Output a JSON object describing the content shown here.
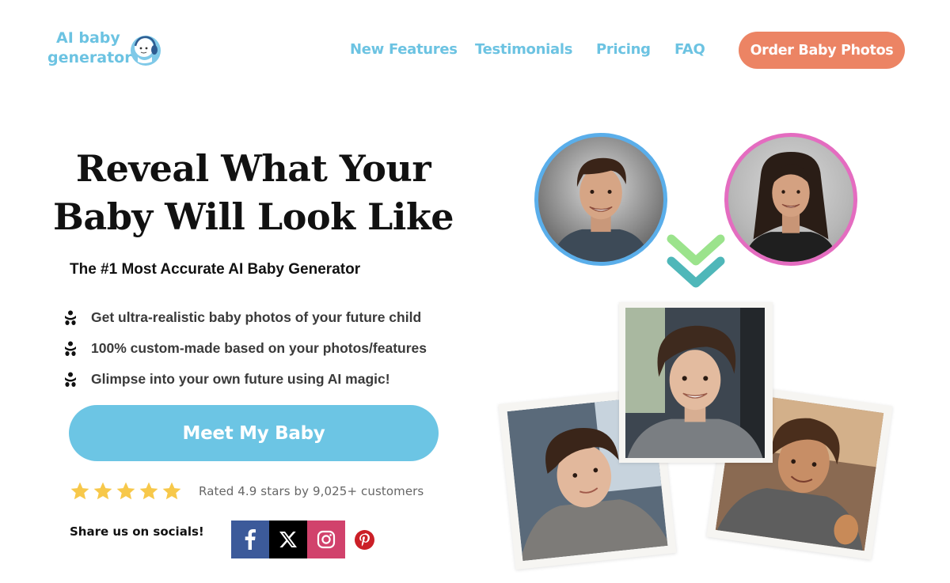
{
  "header": {
    "logo": {
      "line1": "AI baby",
      "line2": "generator",
      "icon": "baby-headphones-icon"
    },
    "nav": [
      {
        "label": "New Features"
      },
      {
        "label": "Testimonials"
      },
      {
        "label": "Pricing"
      },
      {
        "label": "FAQ"
      }
    ],
    "order_button": "Order Baby Photos"
  },
  "hero": {
    "headline_line1": "Reveal What Your",
    "headline_line2": "Baby Will Look Like",
    "subheadline": "The #1 Most Accurate AI Baby Generator",
    "features": [
      {
        "icon": "baby-icon",
        "text": "Get ultra-realistic baby photos of your future child"
      },
      {
        "icon": "baby-icon",
        "text": "100% custom-made based on your photos/features"
      },
      {
        "icon": "baby-icon",
        "text": "Glimpse into your own future using AI magic!"
      }
    ],
    "cta_button": "Meet My Baby",
    "rating": {
      "stars": 5,
      "text": "Rated 4.9 stars by 9,025+ customers"
    },
    "share": {
      "label": "Share us on socials!",
      "networks": [
        {
          "name": "facebook",
          "icon": "facebook-icon"
        },
        {
          "name": "x",
          "icon": "x-icon"
        },
        {
          "name": "instagram",
          "icon": "instagram-icon"
        },
        {
          "name": "pinterest",
          "icon": "pinterest-icon"
        }
      ]
    }
  },
  "visual": {
    "parents": [
      {
        "role": "father",
        "ring_color": "#5aaeea"
      },
      {
        "role": "mother",
        "ring_color": "#e46cc0"
      }
    ],
    "arrow_colors": [
      "#9be38c",
      "#4fb7b9"
    ],
    "children_photos": 3
  },
  "colors": {
    "brand_blue": "#6cc3e2",
    "cta_blue": "#6cc5e4",
    "order_orange": "#ec8464",
    "star_yellow": "#f7c84a",
    "facebook": "#3c5a9a",
    "instagram": "#d1426c",
    "pinterest": "#cb1f27"
  }
}
